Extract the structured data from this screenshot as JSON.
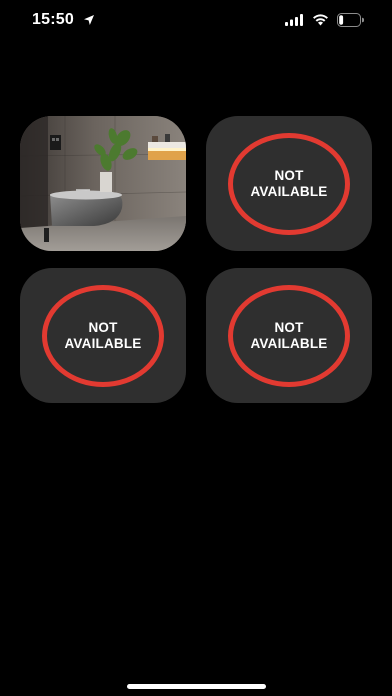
{
  "status_bar": {
    "time": "15:50",
    "icons": [
      "location-arrow-icon",
      "cellular-signal-icon",
      "wifi-icon",
      "battery-icon"
    ],
    "battery_level": 0.2
  },
  "colors": {
    "background": "#000000",
    "tile": "#2f2f2f",
    "ring": "#e23a31",
    "text": "#ffffff"
  },
  "tiles": [
    {
      "kind": "image",
      "image": "bathroom-toilet-photo"
    },
    {
      "kind": "not-available",
      "line1": "NOT",
      "line2": "AVAILABLE"
    },
    {
      "kind": "not-available",
      "line1": "NOT",
      "line2": "AVAILABLE"
    },
    {
      "kind": "not-available",
      "line1": "NOT",
      "line2": "AVAILABLE"
    }
  ]
}
